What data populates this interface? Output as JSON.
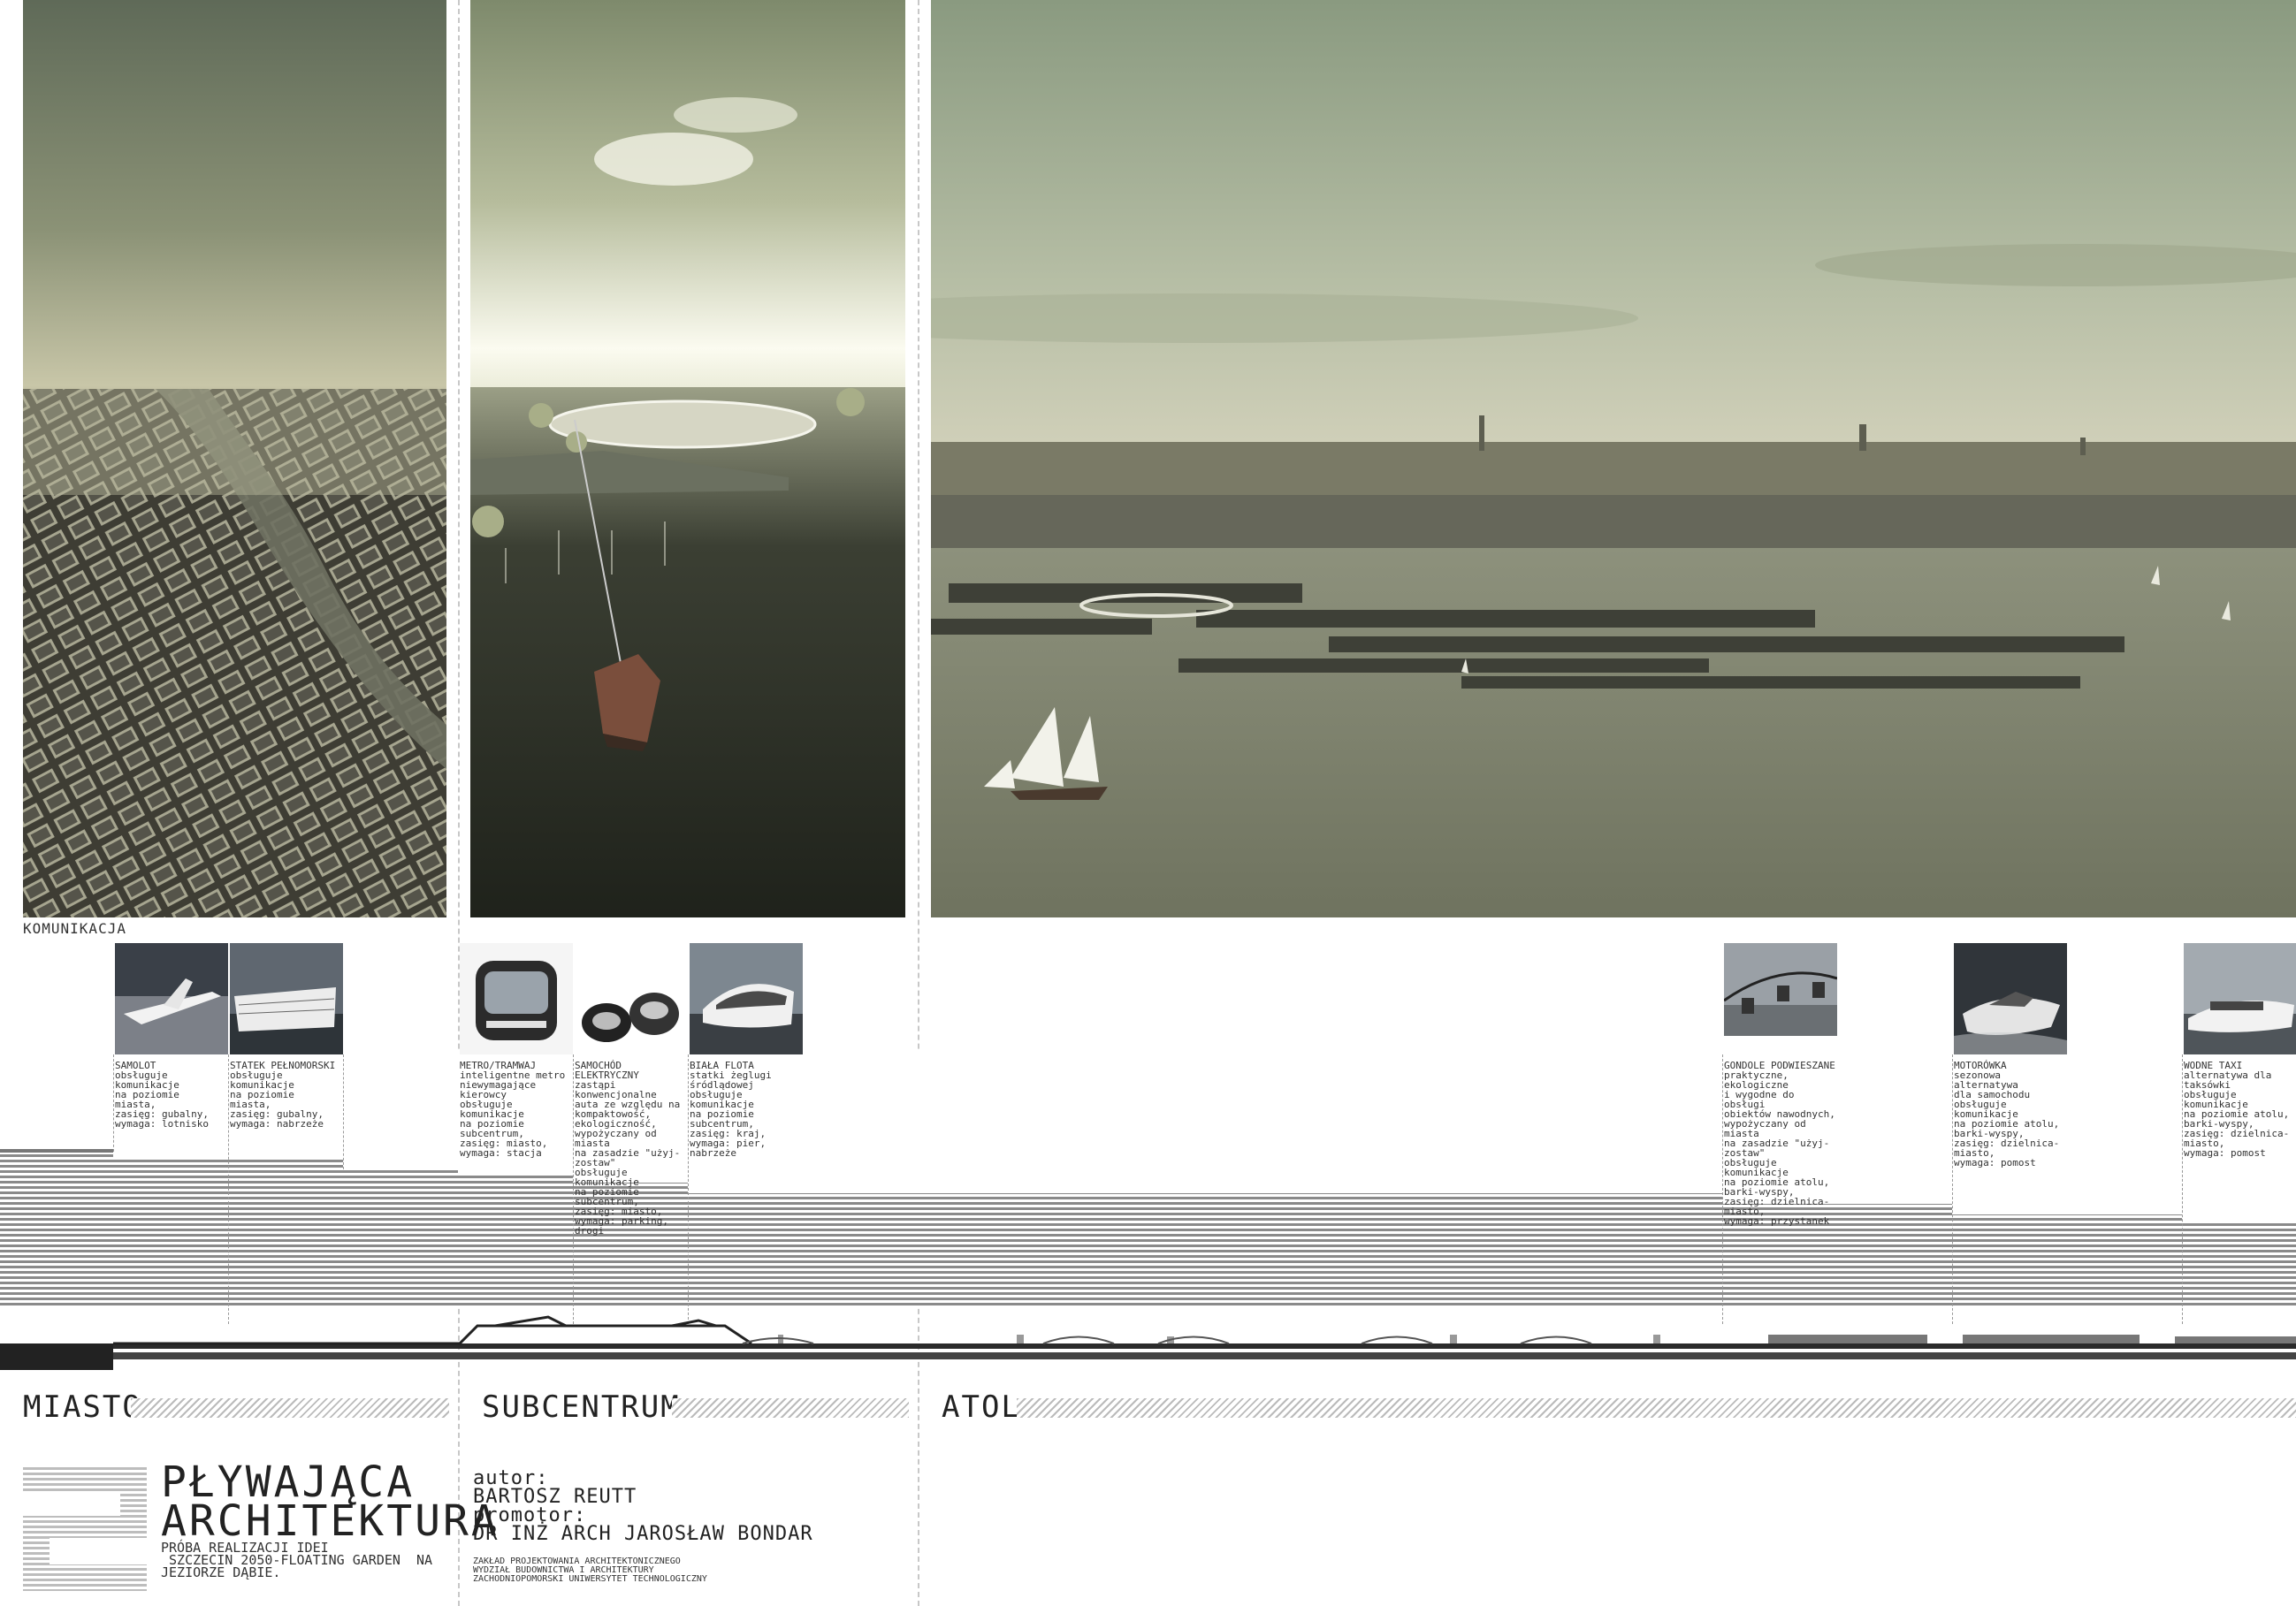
{
  "section_label": "KOMUNIKACJA",
  "transport": [
    {
      "title": "SAMOLOT",
      "text": "obsługuje komunikacje\nna poziomie miasta,\nzasięg: gubalny,\nwymaga: lotnisko"
    },
    {
      "title": "STATEK PEŁNOMORSKI",
      "text": "obsługuje komunikacje\nna poziomie miasta,\nzasięg: gubalny,\nwymaga: nabrzeże"
    },
    {
      "title": "METRO/TRAMWAJ",
      "text": "inteligentne metro\nniewymagające kierowcy\nobsługuje komunikacje\nna poziomie subcentrum,\nzasięg: miasto,\nwymaga: stacja"
    },
    {
      "title": "SAMOCHÓD\nELEKTRYCZNY",
      "text": "zastąpi konwencjonalne\nauta ze względu na\nkompaktowość,\nekologiczność,\nwypożyczany od miasta\nna zasadzie \"użyj-\nzostaw\"\nobsługuje komunikacje\nna poziomie subcentrum,\nzasięg: miasto,\nwymaga: parking, drogi"
    },
    {
      "title": "BIAŁA FLOTA",
      "text": "statki żeglugi\nśródlądowej\nobsługuje komunikacje\nna poziomie subcentrum,\nzasięg: kraj,\nwymaga: pier, nabrzeże"
    },
    {
      "title": "GONDOLE PODWIESZANE",
      "text": "praktyczne, ekologiczne\ni wygodne do obsługi\nobiektów nawodnych,\nwypożyczany od miasta\nna zasadzie \"użyj-\nzostaw\"\nobsługuje komunikacje\nna poziomie atolu,\nbarki-wyspy,\nzasięg: dzielnica-miasto,\nwymaga: przystanek"
    },
    {
      "title": "MOTORÓWKA",
      "text": "sezonowa alternatywa\ndla samochodu\nobsługuje komunikacje\nna poziomie atolu,\nbarki-wyspy,\nzasięg: dzielnica-miasto,\nwymaga: pomost"
    },
    {
      "title": "WODNE TAXI",
      "text": "alternatywa dla\ntaksówki\nobsługuje komunikacje\nna poziomie atolu,\nbarki-wyspy,\nzasięg: dzielnica-miasto,\nwymaga: pomost"
    }
  ],
  "zones": {
    "miasto": "MIASTO",
    "subcentrum": "SUBCENTRUM",
    "atol": "ATOL"
  },
  "title": {
    "number": "2",
    "line1": "PŁYWAJĄCA",
    "line2": "ARCHITEKTURA",
    "sub1": "PRÓBA REALIZACJI IDEI",
    "sub2": " SZCZECIN 2050-FLOATING GARDEN  NA",
    "sub3": "JEZIORZE DĄBIE."
  },
  "credits": {
    "author_label": "autor:",
    "author": "BARTOSZ REUTT",
    "promoter_label": "promotor:",
    "promoter": "DR INŻ ARCH JAROSŁAW BONDAR",
    "inst1": "ZAKŁAD PROJEKTOWANIA ARCHITEKTONICZNEGO",
    "inst2": "WYDZIAŁ BUDOWNICTWA I ARCHITEKTURY",
    "inst3": "ZACHODNIOPOMORSKI UNIWERSYTET TECHNOLOGICZNY"
  },
  "colors": {
    "sky": "#8e977a",
    "water": "#4d5346",
    "city": "#5a5a4a",
    "dark": "#2b2b2b"
  }
}
